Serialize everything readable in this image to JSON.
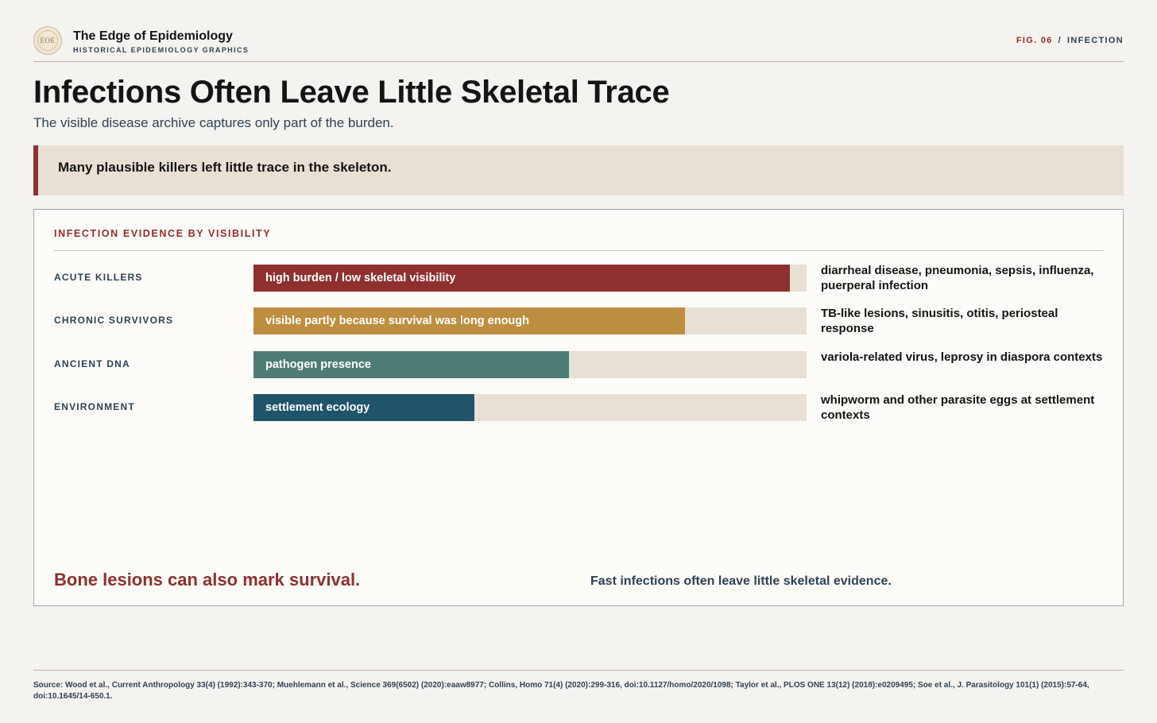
{
  "brand": {
    "logo_text": "EOE",
    "title": "The Edge of Epidemiology",
    "subtitle": "HISTORICAL EPIDEMIOLOGY GRAPHICS"
  },
  "figure": {
    "number": "FIG. 06",
    "separator": "/",
    "topic": "INFECTION"
  },
  "title": "Infections Often Leave Little Skeletal Trace",
  "subtitle": "The visible disease archive captures only part of the burden.",
  "callout": "Many plausible killers left little trace in the skeleton.",
  "colors": {
    "accent_red": "#8f3030",
    "navy_text": "#2f4254",
    "track": "#e8e0d4"
  },
  "chart_data": {
    "type": "bar",
    "orientation": "horizontal",
    "title": "INFECTION EVIDENCE BY VISIBILITY",
    "xlim": [
      0,
      1
    ],
    "categories": [
      "ACUTE KILLERS",
      "CHRONIC SURVIVORS",
      "ANCIENT DNA",
      "ENVIRONMENT"
    ],
    "values": [
      0.97,
      0.78,
      0.57,
      0.4
    ],
    "bar_labels": [
      "high burden / low skeletal visibility",
      "visible partly because survival was long enough",
      "pathogen presence",
      "settlement ecology"
    ],
    "bar_colors": [
      "#8f3030",
      "#bd8e40",
      "#4e7c74",
      "#20546a"
    ],
    "notes": [
      "diarrheal disease, pneumonia, sepsis, influenza, puerperal infection",
      "TB-like lesions, sinusitis, otitis, periosteal response",
      "variola-related virus, leprosy in diaspora contexts",
      "whipworm and other parasite eggs at settlement contexts"
    ],
    "annotations": [
      "Bone lesions can also mark survival.",
      "Fast infections often leave little skeletal evidence."
    ]
  },
  "source": "Source: Wood et al., Current Anthropology 33(4) (1992):343-370; Muehlemann et al., Science 369(6502) (2020):eaaw8977; Collins, Homo 71(4) (2020):299-316, doi:10.1127/homo/2020/1098; Taylor et al., PLOS ONE 13(12) (2018):e0209495; Soe et al., J. Parasitology 101(1) (2015):57-64, doi:10.1645/14-650.1."
}
